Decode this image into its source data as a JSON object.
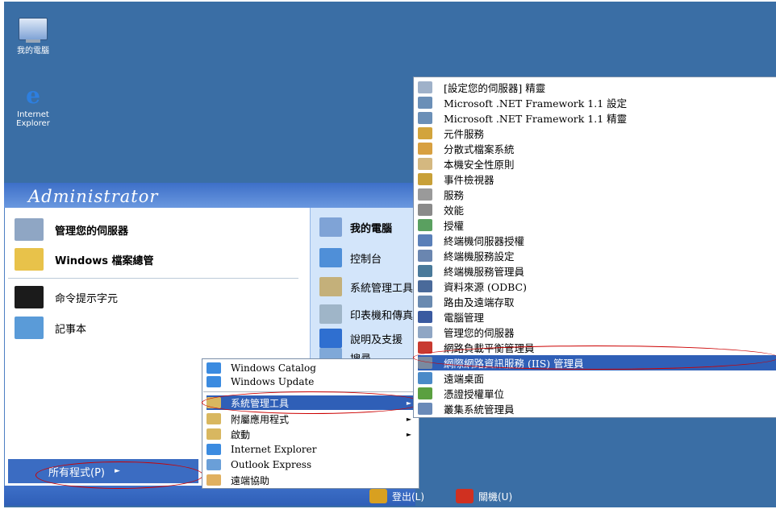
{
  "desktop": {
    "icons": [
      {
        "label": "我的電腦",
        "icon": "my-computer-icon"
      },
      {
        "label": "Internet",
        "label2": "Explorer",
        "icon": "ie-icon"
      }
    ]
  },
  "start_menu": {
    "user": "Administrator",
    "pinned": [
      {
        "label": "管理您的伺服器",
        "icon": "manage-server-icon",
        "color": "#8fa6c4"
      },
      {
        "label": "Windows 檔案總管",
        "icon": "explorer-folder-icon",
        "color": "#e8c24a"
      }
    ],
    "recent": [
      {
        "label": "命令提示字元",
        "icon": "cmd-icon",
        "color": "#1b1b1b"
      },
      {
        "label": "記事本",
        "icon": "notepad-icon",
        "color": "#5a9bd8"
      }
    ],
    "right": [
      {
        "label": "我的電腦",
        "icon": "my-computer-icon",
        "color": "#7fa3d6"
      },
      {
        "label": "控制台",
        "icon": "control-panel-icon",
        "color": "#4f8fd8"
      },
      {
        "label": "系統管理工具",
        "icon": "admin-tools-icon",
        "color": "#c4b07a"
      },
      {
        "label": "印表機和傳真",
        "icon": "printer-icon",
        "color": "#9fb5c8"
      },
      {
        "label": "說明及支援",
        "icon": "help-icon",
        "color": "#2f6fd0"
      },
      {
        "label": "搜尋",
        "icon": "search-icon",
        "color": "#7fa8d8"
      }
    ],
    "all_programs": "所有程式(P)",
    "logoff": "登出(L)",
    "shutdown": "關機(U)"
  },
  "programs_menu": {
    "items": [
      {
        "label": "Windows Catalog",
        "icon": "windows-catalog-icon",
        "color": "#3b8be0"
      },
      {
        "label": "Windows Update",
        "icon": "windows-update-icon",
        "color": "#3b8be0"
      },
      {
        "label": "系統管理工具",
        "icon": "program-group-icon",
        "color": "#d8b760",
        "arrow": "►",
        "selected": true
      },
      {
        "label": "附屬應用程式",
        "icon": "program-group-icon",
        "color": "#d8b760",
        "arrow": "►"
      },
      {
        "label": "啟動",
        "icon": "program-group-icon",
        "color": "#d8b760",
        "arrow": "►"
      },
      {
        "label": "Internet Explorer",
        "icon": "ie-icon",
        "color": "#3b8be0"
      },
      {
        "label": "Outlook Express",
        "icon": "outlook-icon",
        "color": "#6a9fd8"
      },
      {
        "label": "遠端協助",
        "icon": "remote-assist-icon",
        "color": "#e0b060"
      }
    ]
  },
  "admin_tools_menu": {
    "items": [
      {
        "label": "[設定您的伺服器] 精靈",
        "icon": "configure-server-icon",
        "color": "#9fb1c9"
      },
      {
        "label": "Microsoft .NET Framework 1.1 設定",
        "icon": "dotnet-config-icon",
        "color": "#6b8fb7"
      },
      {
        "label": "Microsoft .NET Framework 1.1 精靈",
        "icon": "dotnet-wizard-icon",
        "color": "#6b8fb7"
      },
      {
        "label": "元件服務",
        "icon": "component-services-icon",
        "color": "#d2a43c"
      },
      {
        "label": "分散式檔案系統",
        "icon": "dfs-icon",
        "color": "#d8a040"
      },
      {
        "label": "本機安全性原則",
        "icon": "security-policy-icon",
        "color": "#d4b880"
      },
      {
        "label": "事件檢視器",
        "icon": "event-viewer-icon",
        "color": "#c8a038"
      },
      {
        "label": "服務",
        "icon": "services-icon",
        "color": "#9a9a9a"
      },
      {
        "label": "效能",
        "icon": "performance-icon",
        "color": "#8a8a8a"
      },
      {
        "label": "授權",
        "icon": "licensing-icon",
        "color": "#5aa060"
      },
      {
        "label": "終端機伺服器授權",
        "icon": "ts-licensing-icon",
        "color": "#5a7fb8"
      },
      {
        "label": "終端機服務設定",
        "icon": "ts-config-icon",
        "color": "#6a86b0"
      },
      {
        "label": "終端機服務管理員",
        "icon": "ts-manager-icon",
        "color": "#4a7a9a"
      },
      {
        "label": "資料來源 (ODBC)",
        "icon": "odbc-icon",
        "color": "#4a6a9a"
      },
      {
        "label": "路由及遠端存取",
        "icon": "routing-icon",
        "color": "#6a8ab0"
      },
      {
        "label": "電腦管理",
        "icon": "computer-management-icon",
        "color": "#3a5aa0"
      },
      {
        "label": "管理您的伺服器",
        "icon": "manage-server-icon",
        "color": "#8fa6c4"
      },
      {
        "label": "網路負載平衡管理員",
        "icon": "nlb-icon",
        "color": "#c83a30"
      },
      {
        "label": "網際網路資訊服務 (IIS) 管理員",
        "icon": "iis-manager-icon",
        "color": "#7a8aa0",
        "selected": true
      },
      {
        "label": "遠端桌面",
        "icon": "remote-desktop-icon",
        "color": "#4a8ac8"
      },
      {
        "label": "憑證授權單位",
        "icon": "certificate-authority-icon",
        "color": "#5aa040"
      },
      {
        "label": "叢集系統管理員",
        "icon": "cluster-admin-icon",
        "color": "#6a8ab8"
      }
    ]
  }
}
